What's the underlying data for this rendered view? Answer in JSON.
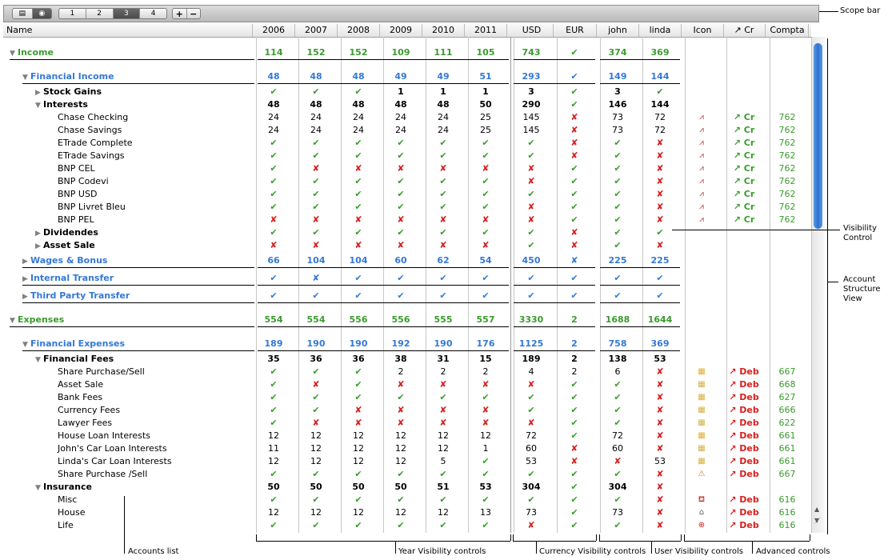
{
  "scope_bar": {
    "segments": [
      "1",
      "2",
      "3",
      "4"
    ],
    "selected": "3",
    "add": "+",
    "remove": "−"
  },
  "columns": {
    "name": "Name",
    "years": [
      "2006",
      "2007",
      "2008",
      "2009",
      "2010",
      "2011"
    ],
    "currencies": [
      "USD",
      "EUR"
    ],
    "users": [
      "john",
      "linda"
    ],
    "advanced": [
      "Icon",
      "↗ Cr",
      "Compta"
    ]
  },
  "colors": {
    "green": "#3a9b2e",
    "blue": "#3478d8",
    "red": "#d62020"
  },
  "rows": [
    {
      "label": "Income",
      "level": 0,
      "tri": "▼",
      "group": "g1",
      "v": [
        "114",
        "152",
        "152",
        "109",
        "111",
        "105",
        "743",
        "✔",
        "374",
        "369"
      ],
      "sep": true
    },
    {
      "label": "Financial Income",
      "level": 1,
      "tri": "▼",
      "group": "g2",
      "v": [
        "48",
        "48",
        "48",
        "49",
        "49",
        "51",
        "293",
        "✔",
        "149",
        "144"
      ],
      "sep": true
    },
    {
      "label": "Stock Gains",
      "level": 2,
      "tri": "▶",
      "group": "g3",
      "v": [
        "✔",
        "✔",
        "✔",
        "1",
        "1",
        "1",
        "3",
        "✔",
        "3",
        "✔"
      ]
    },
    {
      "label": "Interests",
      "level": 2,
      "tri": "▼",
      "group": "g3",
      "v": [
        "48",
        "48",
        "48",
        "48",
        "48",
        "50",
        "290",
        "✔",
        "146",
        "144"
      ]
    },
    {
      "label": "Chase Checking",
      "level": 3,
      "v": [
        "24",
        "24",
        "24",
        "24",
        "24",
        "25",
        "145",
        "✘",
        "73",
        "72"
      ],
      "adv": [
        "chart",
        "↗ Cr",
        "762"
      ]
    },
    {
      "label": "Chase Savings",
      "level": 3,
      "v": [
        "24",
        "24",
        "24",
        "24",
        "24",
        "25",
        "145",
        "✘",
        "73",
        "72"
      ],
      "adv": [
        "chart",
        "↗ Cr",
        "762"
      ]
    },
    {
      "label": "ETrade Complete",
      "level": 3,
      "v": [
        "✔",
        "✔",
        "✔",
        "✔",
        "✔",
        "✔",
        "✔",
        "✘",
        "✔",
        "✘"
      ],
      "adv": [
        "chart",
        "↗ Cr",
        "762"
      ]
    },
    {
      "label": "ETrade Savings",
      "level": 3,
      "v": [
        "✔",
        "✔",
        "✔",
        "✔",
        "✔",
        "✔",
        "✔",
        "✘",
        "✔",
        "✘"
      ],
      "adv": [
        "chart",
        "↗ Cr",
        "762"
      ]
    },
    {
      "label": "BNP CEL",
      "level": 3,
      "v": [
        "✔",
        "✘",
        "✘",
        "✘",
        "✘",
        "✘",
        "✘",
        "✔",
        "✔",
        "✘"
      ],
      "adv": [
        "chart",
        "↗ Cr",
        "762"
      ]
    },
    {
      "label": "BNP Codevi",
      "level": 3,
      "v": [
        "✔",
        "✔",
        "✔",
        "✔",
        "✔",
        "✔",
        "✘",
        "✔",
        "✔",
        "✘"
      ],
      "adv": [
        "chart",
        "↗ Cr",
        "762"
      ]
    },
    {
      "label": "BNP USD",
      "level": 3,
      "v": [
        "✔",
        "✔",
        "✔",
        "✔",
        "✔",
        "✔",
        "✔",
        "✔",
        "✔",
        "✘"
      ],
      "adv": [
        "chart",
        "↗ Cr",
        "762"
      ]
    },
    {
      "label": "BNP Livret Bleu",
      "level": 3,
      "v": [
        "✔",
        "✔",
        "✔",
        "✔",
        "✔",
        "✔",
        "✘",
        "✔",
        "✔",
        "✘"
      ],
      "adv": [
        "chart",
        "↗ Cr",
        "762"
      ]
    },
    {
      "label": "BNP PEL",
      "level": 3,
      "v": [
        "✘",
        "✘",
        "✘",
        "✘",
        "✘",
        "✘",
        "✘",
        "✔",
        "✔",
        "✘"
      ],
      "adv": [
        "chart",
        "↗ Cr",
        "762"
      ]
    },
    {
      "label": "Dividendes",
      "level": 2,
      "tri": "▶",
      "group": "g3",
      "v": [
        "✔",
        "✔",
        "✔",
        "✔",
        "✔",
        "✔",
        "✔",
        "✘",
        "✔",
        "✔"
      ]
    },
    {
      "label": "Asset Sale",
      "level": 2,
      "tri": "▶",
      "group": "g3",
      "v": [
        "✘",
        "✘",
        "✘",
        "✘",
        "✘",
        "✘",
        "✔",
        "✘",
        "✔",
        "✘"
      ]
    },
    {
      "label": "Wages & Bonus",
      "level": 1,
      "tri": "▶",
      "group": "g2",
      "v": [
        "66",
        "104",
        "104",
        "60",
        "62",
        "54",
        "450",
        "✘",
        "225",
        "225"
      ],
      "sep": true
    },
    {
      "label": "Internal Transfer",
      "level": 1,
      "tri": "▶",
      "group": "g2",
      "v": [
        "✔",
        "✘",
        "✔",
        "✔",
        "✔",
        "✔",
        "✔",
        "✔",
        "✔",
        "✔"
      ],
      "sep": true
    },
    {
      "label": "Third Party Transfer",
      "level": 1,
      "tri": "▶",
      "group": "g2",
      "v": [
        "✔",
        "✔",
        "✔",
        "✔",
        "✔",
        "✔",
        "✔",
        "✔",
        "✔",
        "✔"
      ],
      "sep": true
    },
    {
      "label": "Expenses",
      "level": 0,
      "tri": "▼",
      "group": "g1",
      "v": [
        "554",
        "554",
        "556",
        "556",
        "555",
        "557",
        "3330",
        "2",
        "1688",
        "1644"
      ],
      "sep": true
    },
    {
      "label": "Financial Expenses",
      "level": 1,
      "tri": "▼",
      "group": "g2",
      "v": [
        "189",
        "190",
        "190",
        "192",
        "190",
        "176",
        "1125",
        "2",
        "758",
        "369"
      ],
      "sep": true
    },
    {
      "label": "Financial Fees",
      "level": 2,
      "tri": "▼",
      "group": "g3",
      "v": [
        "35",
        "36",
        "36",
        "38",
        "31",
        "15",
        "189",
        "2",
        "138",
        "53"
      ]
    },
    {
      "label": "Share Purchase/Sell",
      "level": 3,
      "v": [
        "✔",
        "✔",
        "✔",
        "2",
        "2",
        "2",
        "4",
        "2",
        "6",
        "✘"
      ],
      "adv": [
        "coins",
        "↗ Deb",
        "667"
      ]
    },
    {
      "label": "Asset Sale",
      "level": 3,
      "v": [
        "✔",
        "✘",
        "✔",
        "✘",
        "✘",
        "✘",
        "✘",
        "✔",
        "✔",
        "✘"
      ],
      "adv": [
        "coins",
        "↗ Deb",
        "668"
      ]
    },
    {
      "label": "Bank Fees",
      "level": 3,
      "v": [
        "✔",
        "✔",
        "✔",
        "✔",
        "✔",
        "✔",
        "✔",
        "✔",
        "✔",
        "✘"
      ],
      "adv": [
        "coins",
        "↗ Deb",
        "627"
      ]
    },
    {
      "label": "Currency Fees",
      "level": 3,
      "v": [
        "✔",
        "✔",
        "✘",
        "✘",
        "✘",
        "✘",
        "✔",
        "✔",
        "✔",
        "✘"
      ],
      "adv": [
        "coins",
        "↗ Deb",
        "666"
      ]
    },
    {
      "label": "Lawyer Fees",
      "level": 3,
      "v": [
        "✔",
        "✘",
        "✘",
        "✘",
        "✘",
        "✘",
        "✘",
        "✔",
        "✔",
        "✘"
      ],
      "adv": [
        "coins",
        "↗ Deb",
        "622"
      ]
    },
    {
      "label": "House Loan Interests",
      "level": 3,
      "v": [
        "12",
        "12",
        "12",
        "12",
        "12",
        "12",
        "72",
        "✔",
        "72",
        "✘"
      ],
      "adv": [
        "coins",
        "↗ Deb",
        "661"
      ]
    },
    {
      "label": "John's Car Loan Interests",
      "level": 3,
      "v": [
        "11",
        "12",
        "12",
        "12",
        "12",
        "1",
        "60",
        "✘",
        "60",
        "✘"
      ],
      "adv": [
        "coins",
        "↗ Deb",
        "661"
      ]
    },
    {
      "label": "Linda's Car Loan Interests",
      "level": 3,
      "v": [
        "12",
        "12",
        "12",
        "12",
        "5",
        "✔",
        "53",
        "✘",
        "✘",
        "53"
      ],
      "adv": [
        "coins",
        "↗ Deb",
        "661"
      ]
    },
    {
      "label": "Share Purchase /Sell",
      "level": 3,
      "v": [
        "✔",
        "✔",
        "✔",
        "✔",
        "✔",
        "✔",
        "✔",
        "✔",
        "✔",
        "✘"
      ],
      "adv": [
        "warning",
        "↗ Deb",
        "667"
      ]
    },
    {
      "label": "Insurance",
      "level": 2,
      "tri": "▼",
      "group": "g3",
      "v": [
        "50",
        "50",
        "50",
        "50",
        "51",
        "53",
        "304",
        "✔",
        "304",
        "✘"
      ]
    },
    {
      "label": "Misc",
      "level": 3,
      "v": [
        "✔",
        "✔",
        "✔",
        "✔",
        "✔",
        "✔",
        "✔",
        "✔",
        "✔",
        "✘"
      ],
      "adv": [
        "basket",
        "↗ Deb",
        "616"
      ]
    },
    {
      "label": "House",
      "level": 3,
      "v": [
        "12",
        "12",
        "12",
        "12",
        "12",
        "13",
        "73",
        "✔",
        "73",
        "✘"
      ],
      "adv": [
        "house",
        "↗ Deb",
        "616"
      ]
    },
    {
      "label": "Life",
      "level": 3,
      "v": [
        "✔",
        "✔",
        "✔",
        "✔",
        "✔",
        "✔",
        "✘",
        "✔",
        "✔",
        "✘"
      ],
      "adv": [
        "lifebuoy",
        "↗ Deb",
        "616"
      ]
    }
  ],
  "annotations": {
    "scope_bar": "Scope bar",
    "visibility_control": [
      "Visibility",
      "Control"
    ],
    "structure_view": [
      "Account",
      "Structure",
      "View"
    ],
    "accounts_list": "Accounts list",
    "year_controls": "Year Visibility controls",
    "currency_controls": "Currency Visibility controls",
    "user_controls": "User Visibility controls",
    "advanced_controls": "Advanced controls"
  }
}
